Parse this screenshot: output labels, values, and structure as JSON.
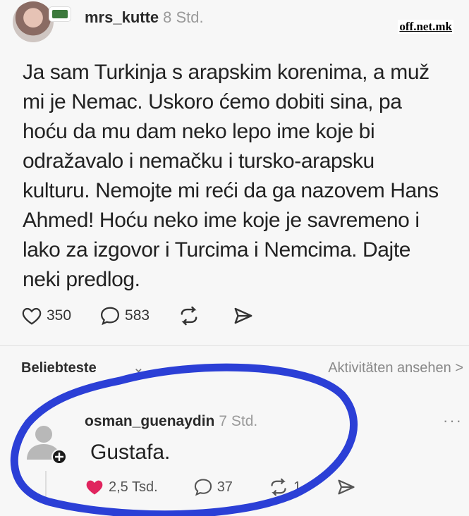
{
  "post": {
    "username": "mrs_kutte",
    "time": "8 Std.",
    "text": "Ja sam Turkinja s arapskim korenima, a muž mi je Nemac. Uskoro ćemo dobiti sina, pa hoću da mu dam neko lepo ime koje bi odražavalo i nemačku i tursko-arapsku kulturu. Nemojte mi reći da ga nazovem Hans Ahmed! Hoću neko ime koje je savremeno i lako za izgovor i Turcima i Nemcima. Dajte neki predlog.",
    "likes": "350",
    "comments": "583"
  },
  "watermark": "off.net.mk",
  "replies_bar": {
    "sort_label": "Beliebteste",
    "activity_link": "Aktivitäten ansehen >"
  },
  "reply": {
    "username": "osman_guenaydin",
    "time": "7 Std.",
    "text": "Gustafa.",
    "likes": "2,5 Tsd.",
    "comments": "37",
    "reposts": "1"
  },
  "colors": {
    "annotation_circle": "#2b3fd6",
    "like_red": "#e0245e"
  }
}
